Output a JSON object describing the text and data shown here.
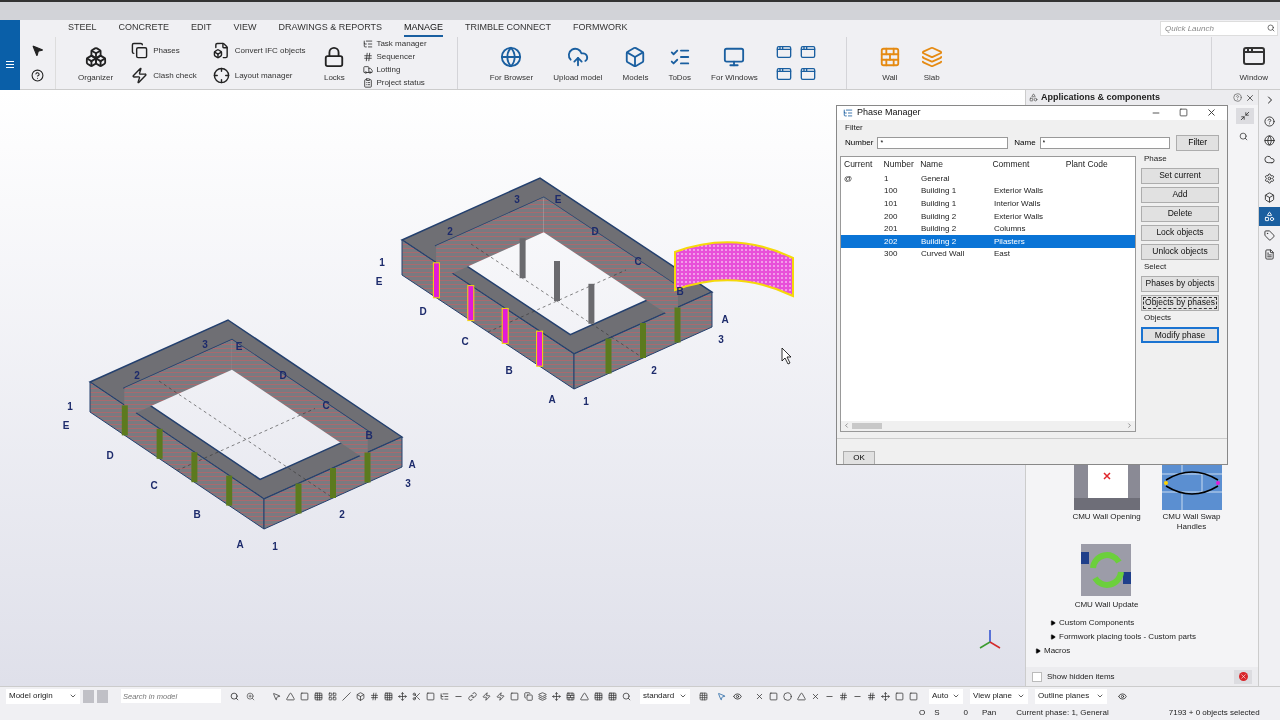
{
  "ribbon": {
    "tabs": [
      {
        "label": "STEEL",
        "selected": false
      },
      {
        "label": "CONCRETE",
        "selected": false
      },
      {
        "label": "EDIT",
        "selected": false
      },
      {
        "label": "VIEW",
        "selected": false
      },
      {
        "label": "DRAWINGS & REPORTS",
        "selected": false
      },
      {
        "label": "MANAGE",
        "selected": true
      },
      {
        "label": "TRIMBLE CONNECT",
        "selected": false
      },
      {
        "label": "FORMWORK",
        "selected": false
      }
    ],
    "quick_launch": {
      "placeholder": "Quick Launch"
    },
    "columns": [
      {
        "kind": "large",
        "label": "Organizer"
      },
      {
        "kind": "stack",
        "items": [
          "Phases",
          "Clash check"
        ]
      },
      {
        "kind": "stack",
        "items": [
          "Convert IFC objects",
          "Layout manager"
        ]
      },
      {
        "kind": "large",
        "label": "Locks"
      },
      {
        "kind": "list",
        "items": [
          "Task manager",
          "Sequencer",
          "Lotting",
          "Project status"
        ]
      },
      {
        "kind": "separator"
      },
      {
        "kind": "large",
        "label": "For Browser"
      },
      {
        "kind": "large",
        "label": "Upload model"
      },
      {
        "kind": "large",
        "label": "Models"
      },
      {
        "kind": "large",
        "label": "ToDos"
      },
      {
        "kind": "large",
        "label": "For Windows"
      },
      {
        "kind": "grid"
      },
      {
        "kind": "separator"
      },
      {
        "kind": "large",
        "label": "Wall"
      },
      {
        "kind": "large",
        "label": "Slab"
      }
    ],
    "window_button": "Window"
  },
  "model_view": {
    "buildings": [
      {
        "grid_labels": [
          "1",
          "E",
          "D",
          "C",
          "B",
          "A",
          "1",
          "2",
          "3",
          "A",
          "B",
          "C",
          "D",
          "E",
          "3",
          "2"
        ]
      },
      {
        "grid_labels": [
          "1",
          "E",
          "D",
          "C",
          "B",
          "A",
          "1",
          "2",
          "3",
          "A",
          "B",
          "C",
          "D",
          "E",
          "3",
          "2"
        ]
      }
    ]
  },
  "phase_manager": {
    "title": "Phase Manager",
    "filter": {
      "title": "Filter",
      "number_label": "Number",
      "number_value": "*",
      "name_label": "Name",
      "name_value": "*",
      "button": "Filter"
    },
    "columns": [
      "Current",
      "Number",
      "Name",
      "Comment",
      "Plant Code"
    ],
    "rows": [
      {
        "current": "@",
        "number": "1",
        "name": "General",
        "selected": false
      },
      {
        "number": "100",
        "name": "Building 1",
        "comment": "Exterior Walls",
        "selected": false
      },
      {
        "number": "101",
        "name": "Building 1",
        "comment": "Interior Walls",
        "selected": false
      },
      {
        "number": "200",
        "name": "Building 2",
        "comment": "Exterior Walls",
        "selected": false
      },
      {
        "number": "201",
        "name": "Building 2",
        "comment": "Columns",
        "selected": false
      },
      {
        "number": "202",
        "name": "Building 2",
        "comment": "Pilasters",
        "selected": true
      },
      {
        "number": "300",
        "name": "Curved Wall",
        "comment": "East",
        "selected": false
      }
    ],
    "groups": [
      {
        "title": "Phase",
        "buttons": [
          {
            "label": "Set current",
            "focused": false,
            "default": false
          },
          {
            "label": "Add",
            "focused": false,
            "default": false
          },
          {
            "label": "Delete",
            "focused": false,
            "default": false
          },
          {
            "label": "Lock objects",
            "focused": false,
            "default": false
          },
          {
            "label": "Unlock objects",
            "focused": false,
            "default": false
          }
        ]
      },
      {
        "title": "Select",
        "buttons": [
          {
            "label": "Phases by objects",
            "focused": false,
            "default": false
          },
          {
            "label": "Objects by phases",
            "focused": true,
            "default": false
          }
        ]
      },
      {
        "title": "Objects",
        "buttons": [
          {
            "label": "Modify phase",
            "focused": false,
            "default": true
          }
        ]
      }
    ],
    "ok_button": "OK"
  },
  "components_panel": {
    "title": "Applications & components",
    "components": [
      {
        "label": "CMU Wall Opening"
      },
      {
        "label": "CMU Wall Swap Handles"
      },
      {
        "label": "CMU Wall Update"
      }
    ],
    "subcategories": [
      {
        "label": "Custom Components",
        "expanded": false
      },
      {
        "label": "Formwork placing tools - Custom parts",
        "expanded": false
      }
    ],
    "categories": [
      {
        "label": "Macros",
        "expanded": false
      }
    ],
    "show_hidden": {
      "label": "Show hidden items",
      "checked": false
    }
  },
  "side_tabs": [
    {
      "selected": false
    },
    {
      "selected": false
    },
    {
      "selected": false
    },
    {
      "selected": false
    },
    {
      "selected": false
    },
    {
      "selected": true
    },
    {
      "selected": false
    },
    {
      "selected": false
    }
  ],
  "bottom_toolbar": {
    "origin": "Model origin",
    "search": {
      "placeholder": "Search in model"
    },
    "standard": "standard",
    "auto": "Auto",
    "view_plane": "View plane",
    "outline_planes": "Outline planes"
  },
  "status_bar": [
    "O",
    "S",
    "0",
    "Pan",
    "Current phase: 1, General",
    "7193 + 0 objects selected"
  ]
}
